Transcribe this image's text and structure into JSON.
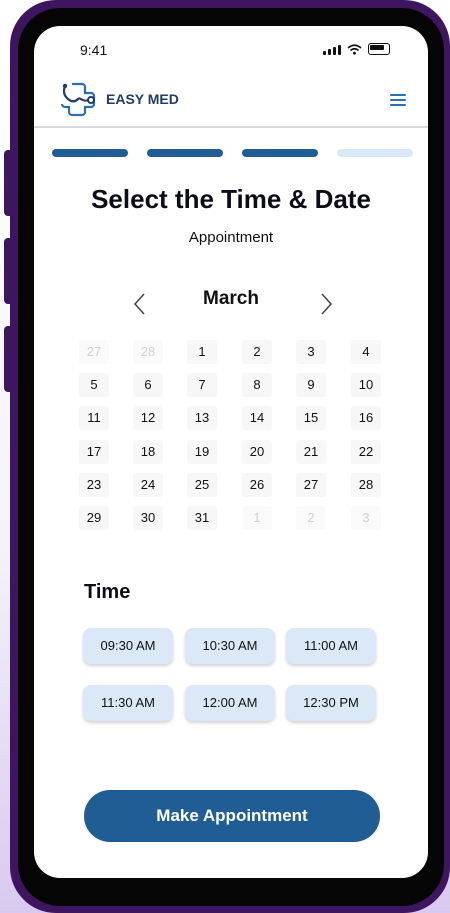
{
  "status": {
    "time": "9:41"
  },
  "app": {
    "name": "EASY MED"
  },
  "colors": {
    "primary": "#1f5d94",
    "progress_done": "#1f5d94",
    "progress_todo": "#d9e8f7",
    "slot_bg": "#dbe8f7"
  },
  "progress": {
    "steps_total": 4,
    "steps_done": 3
  },
  "page": {
    "title": "Select the Time & Date",
    "subtitle": "Appointment"
  },
  "calendar": {
    "month": "March",
    "days": [
      "27",
      "28",
      "1",
      "2",
      "3",
      "4",
      "5",
      "6",
      "7",
      "8",
      "9",
      "10",
      "11",
      "12",
      "13",
      "14",
      "15",
      "16",
      "17",
      "18",
      "19",
      "20",
      "21",
      "22",
      "23",
      "24",
      "25",
      "26",
      "27",
      "28",
      "29",
      "30",
      "31",
      "1",
      "2",
      "3"
    ],
    "muted": [
      true,
      true,
      false,
      false,
      false,
      false,
      false,
      false,
      false,
      false,
      false,
      false,
      false,
      false,
      false,
      false,
      false,
      false,
      false,
      false,
      false,
      false,
      false,
      false,
      false,
      false,
      false,
      false,
      false,
      false,
      false,
      false,
      false,
      true,
      true,
      true
    ]
  },
  "time_section": {
    "label": "Time",
    "slots": [
      "09:30 AM",
      "10:30 AM",
      "11:00 AM",
      "11:30 AM",
      "12:00 AM",
      "12:30 PM"
    ]
  },
  "cta": {
    "label": "Make Appointment"
  },
  "icons": {
    "prev": "chevron-left-icon",
    "next": "chevron-right-icon",
    "menu": "hamburger-menu-icon",
    "logo": "stethoscope-cross-logo"
  }
}
